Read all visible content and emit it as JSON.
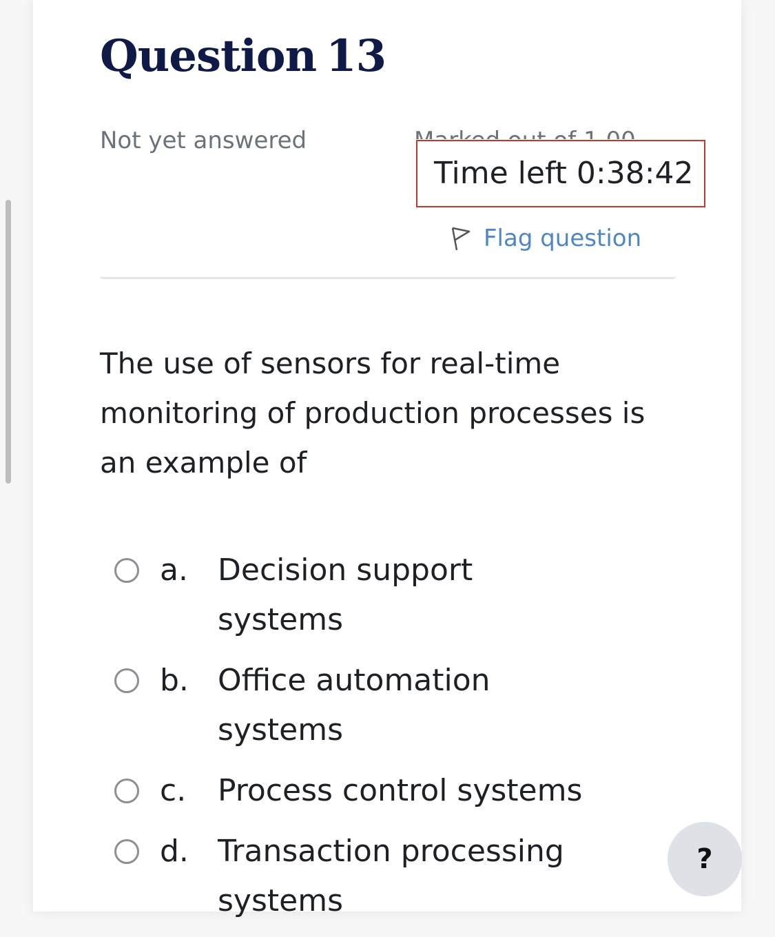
{
  "question": {
    "title_word": "Question",
    "number": "13",
    "state": "Not yet answered",
    "grade": "Marked out of 1.00",
    "flag_label": "Flag question",
    "text": "The use of sensors for real-time monitoring of production processes is an example of"
  },
  "timer": {
    "text": "Time left 0:38:42"
  },
  "answers": [
    {
      "letter": "a.",
      "text": "Decision support systems",
      "selected": false
    },
    {
      "letter": "b.",
      "text": "Office automation systems",
      "selected": false
    },
    {
      "letter": "c.",
      "text": "Process control systems",
      "selected": false
    },
    {
      "letter": "d.",
      "text": "Transaction processing systems",
      "selected": false
    }
  ],
  "help": {
    "label": "?"
  },
  "colors": {
    "title": "#0f1b46",
    "link": "#4f86c6",
    "timer_border": "#c2392b",
    "muted_text": "#6a737b"
  },
  "icons": {
    "flag": "flag-outline-icon",
    "radio": "radio-empty-icon"
  }
}
